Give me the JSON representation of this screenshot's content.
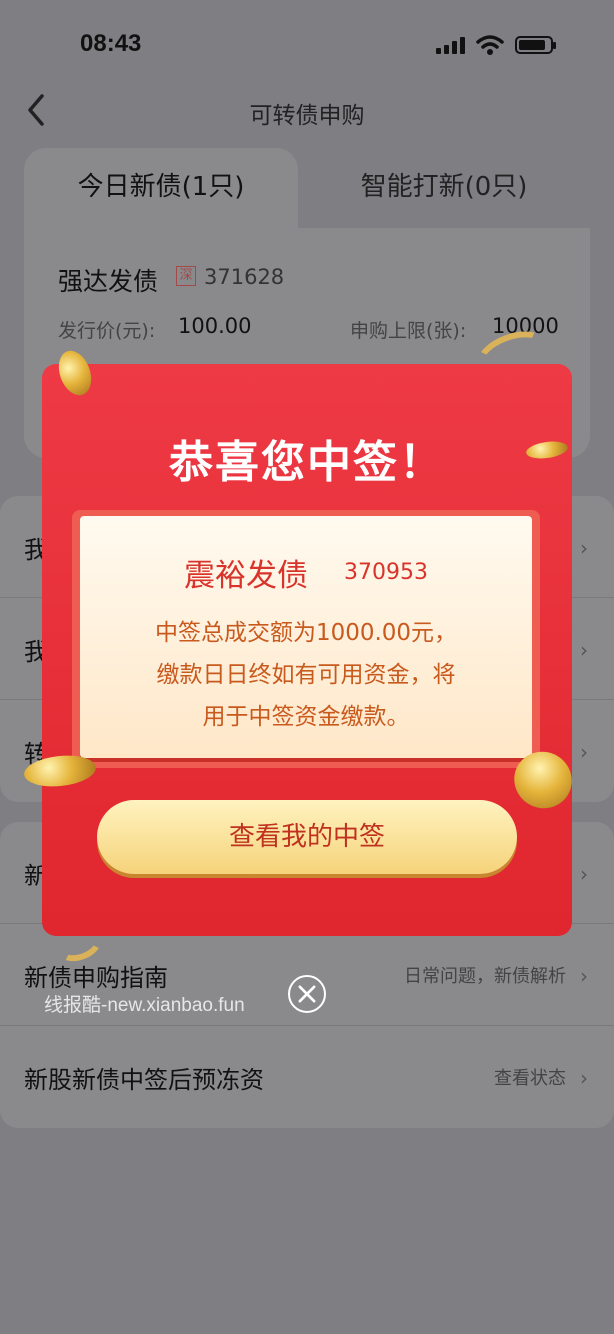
{
  "status_bar": {
    "time": "08:43"
  },
  "nav": {
    "title": "可转债申购"
  },
  "tabs": [
    {
      "label": "今日新债(1只)"
    },
    {
      "label": "智能打新(0只)"
    }
  ],
  "bond": {
    "name": "强达发债",
    "market": "深",
    "code": "371628",
    "price_label": "发行价(元):",
    "price": "100.00",
    "limit_label": "申购上限(张):",
    "limit": "10000"
  },
  "list_group_1": [
    {
      "title": "我"
    },
    {
      "title": "我"
    },
    {
      "title": "转"
    }
  ],
  "list_group_2": [
    {
      "title": "新"
    },
    {
      "title": "新债申购指南",
      "subtitle": "日常问题，新债解析"
    },
    {
      "title": "新股新债中签后预冻资",
      "subtitle": "查看状态"
    }
  ],
  "popup": {
    "title": "恭喜您中签！",
    "bond_name": "震裕发债",
    "bond_code": "370953",
    "message_line1": "中签总成交额为1000.00元，",
    "message_line2": "缴款日日终如有可用资金，将",
    "message_line3": "用于中签资金缴款。",
    "button_label": "查看我的中签"
  },
  "watermark": "线报酷-new.xianbao.fun",
  "colors": {
    "popup_red": "#e0262e",
    "button_gold": "#f5d37a",
    "highlight_red": "#d9342b"
  }
}
